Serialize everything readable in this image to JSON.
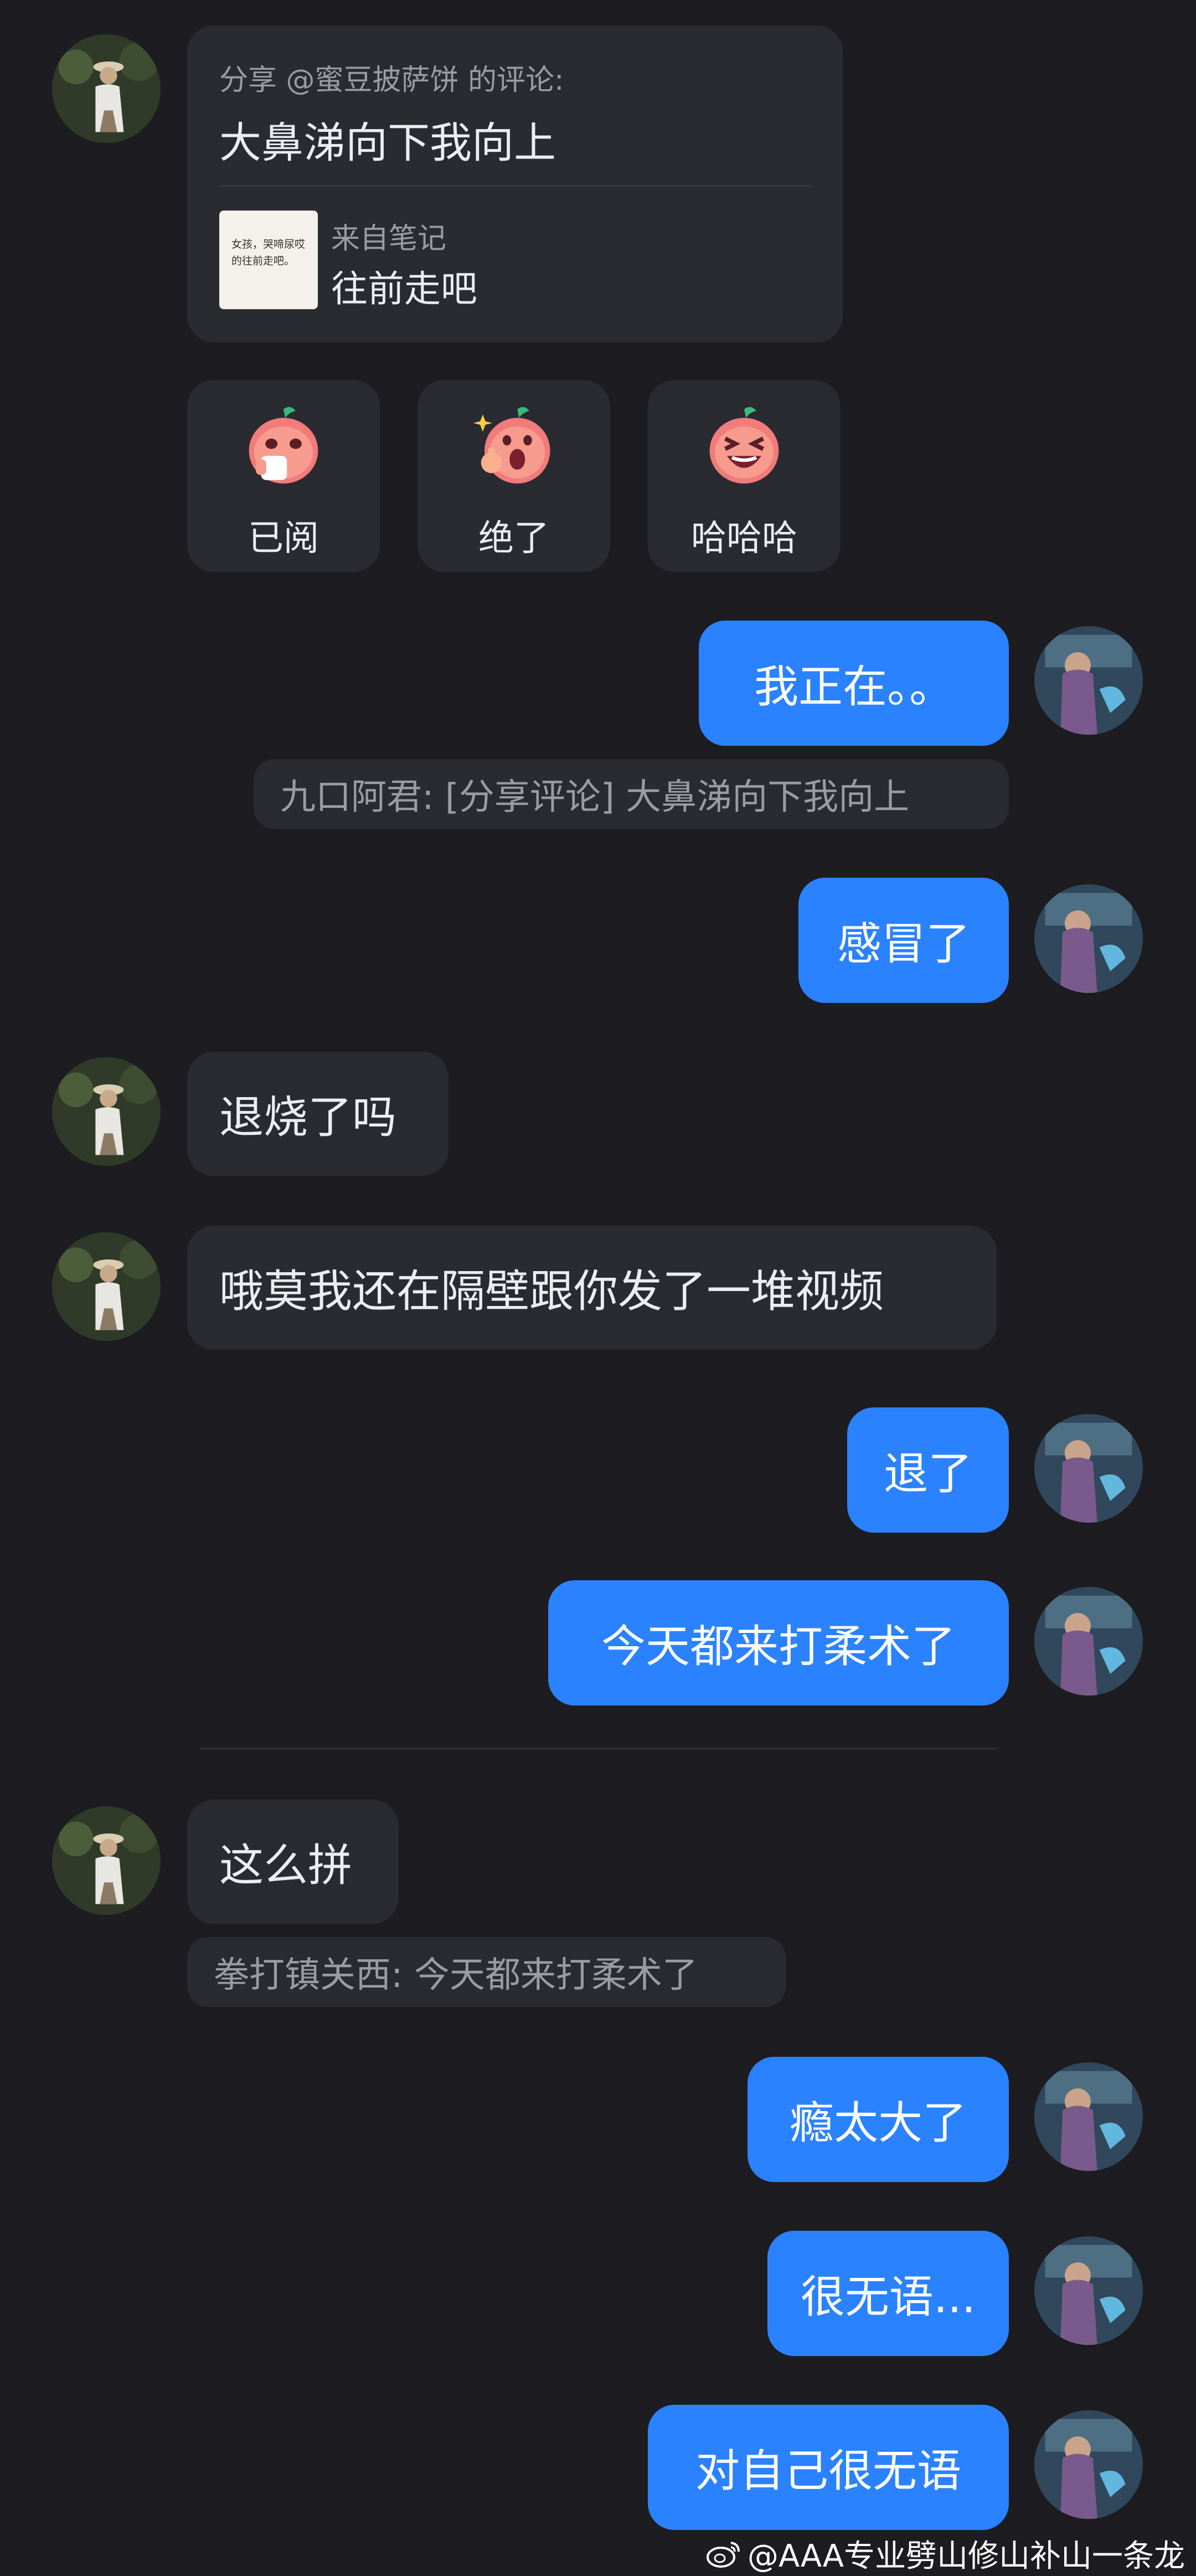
{
  "shared_card": {
    "share_label": "分享 @蜜豆披萨饼 的评论:",
    "comment_text": "大鼻涕向下我向上",
    "thumbnail_text": "女孩，哭啼尿哎的往前走吧。",
    "source_label": "来自笔记",
    "note_title": "往前走吧"
  },
  "reactions": [
    {
      "label": "已阅",
      "icon": "peach-face-read-icon"
    },
    {
      "label": "绝了",
      "icon": "peach-face-amazed-icon"
    },
    {
      "label": "哈哈哈",
      "icon": "peach-face-laughing-icon"
    }
  ],
  "messages": {
    "m1": "我正在。。",
    "q1": "九口阿君: [分享评论] 大鼻涕向下我向上",
    "m2": "感冒了",
    "m3": "退烧了吗",
    "m4": "哦莫我还在隔壁跟你发了一堆视频",
    "m5": "退了",
    "m6": "今天都来打柔术了",
    "m7": "这么拼",
    "q2": "拳打镇关西: 今天都来打柔术了",
    "m8": "瘾太大了",
    "m9": "很无语...",
    "m10": "对自己很无语"
  },
  "watermark": "@AAA专业劈山修山补山一条龙",
  "colors": {
    "background": "#1c1c21",
    "bubble_received": "#2a2a31",
    "bubble_sent": "#2b82ff",
    "text_primary": "#ecedf0",
    "text_secondary": "#9b9ca3"
  }
}
